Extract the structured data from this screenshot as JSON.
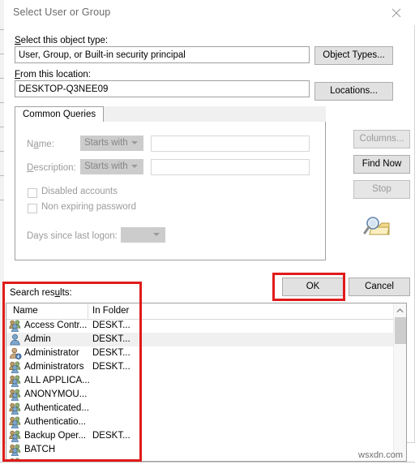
{
  "window": {
    "title": "Select User or Group",
    "close_icon": "close-icon"
  },
  "form": {
    "object_type_label": "Select this object type:",
    "object_type_value": "User, Group, or Built-in security principal",
    "object_types_button": "Object Types...",
    "location_label": "From this location:",
    "location_value": "DESKTOP-Q3NEE09",
    "locations_button": "Locations..."
  },
  "tabs": [
    {
      "label": "Common Queries",
      "active": true
    }
  ],
  "query": {
    "name_label": "Name:",
    "name_condition": "Starts with",
    "name_value": "",
    "description_label": "Description:",
    "description_condition": "Starts with",
    "description_value": "",
    "disabled_accounts_label": "Disabled accounts",
    "disabled_accounts_checked": false,
    "non_expiring_password_label": "Non expiring password",
    "non_expiring_password_checked": false,
    "days_since_logon_label": "Days since last logon:",
    "days_since_logon_value": ""
  },
  "side_buttons": {
    "columns": "Columns...",
    "columns_enabled": false,
    "find_now": "Find Now",
    "find_now_enabled": true,
    "stop": "Stop",
    "stop_enabled": false,
    "decoration_icon": "search-folder-icon"
  },
  "footer": {
    "ok": "OK",
    "cancel": "Cancel"
  },
  "results": {
    "label": "Search results:",
    "columns": [
      "Name",
      "In Folder"
    ],
    "rows": [
      {
        "icon": "group-icon",
        "name": "Access Contr...",
        "folder": "DESKT...",
        "selected": false
      },
      {
        "icon": "user-icon",
        "name": "Admin",
        "folder": "DESKT...",
        "selected": true
      },
      {
        "icon": "user-arrow-icon",
        "name": "Administrator",
        "folder": "DESKT...",
        "selected": false
      },
      {
        "icon": "group-icon",
        "name": "Administrators",
        "folder": "DESKT...",
        "selected": false
      },
      {
        "icon": "group-icon",
        "name": "ALL APPLICA...",
        "folder": "",
        "selected": false
      },
      {
        "icon": "group-icon",
        "name": "ANONYMOU...",
        "folder": "",
        "selected": false
      },
      {
        "icon": "group-icon",
        "name": "Authenticated...",
        "folder": "",
        "selected": false
      },
      {
        "icon": "group-icon",
        "name": "Authenticatio...",
        "folder": "",
        "selected": false
      },
      {
        "icon": "group-icon",
        "name": "Backup Oper...",
        "folder": "DESKT...",
        "selected": false
      },
      {
        "icon": "group-icon",
        "name": "BATCH",
        "folder": "",
        "selected": false
      }
    ],
    "scrollbar": {
      "up_arrow": "chevron-up-icon",
      "down_arrow": "chevron-down-icon"
    }
  },
  "annotations": {
    "highlight_color": "#e01b1b",
    "boxes": [
      "search-results-panel",
      "ok-button"
    ]
  },
  "watermark": "wsxdn.com"
}
